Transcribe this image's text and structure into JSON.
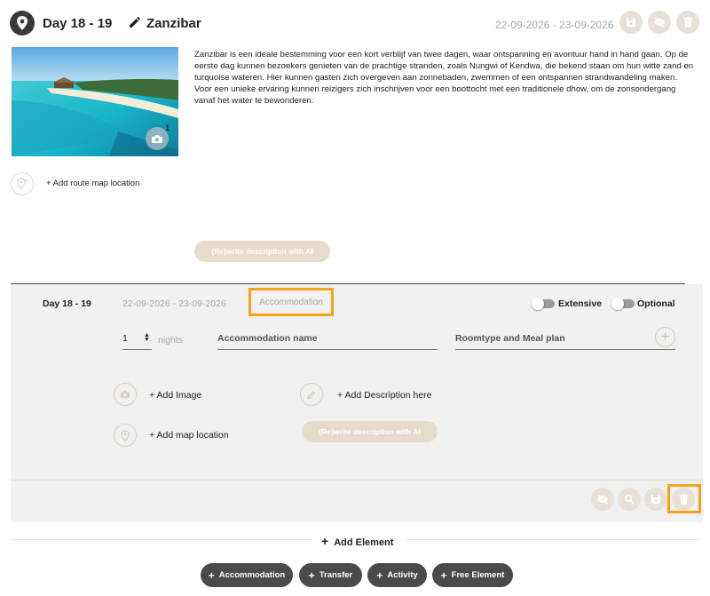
{
  "header": {
    "day_range": "Day 18 - 19",
    "destination": "Zanzibar",
    "dates": "22-09-2026 - 23-09-2026",
    "photo_count": "1"
  },
  "description": "Zanzibar is een ideale bestemming voor een kort verblijf van twee dagen, waar ontspanning en avontuur hand in hand gaan. Op de eerste dag kunnen bezoekers genieten van de prachtige stranden, zoals Nungwi of Kendwa, die bekend staan om hun witte zand en turquoise wateren. Hier kunnen gasten zich overgeven aan zonnebaden, zwemmen of een ontspannen strandwandeling maken. Voor een unieke ervaring kunnen reizigers zich inschrijven voor een boottocht met een traditionele dhow, om de zonsondergang vanaf het water te bewonderen.",
  "route_map_link": "+ Add route map location",
  "rewrite_ai_label": "(Re)write description with AI",
  "element": {
    "day_range": "Day 18 - 19",
    "dates": "22-09-2026 - 23-09-2026",
    "type": "Accommodation",
    "extensive_label": "Extensive",
    "optional_label": "Optional",
    "nights_value": "1",
    "nights_label": "nights",
    "accommodation_name_placeholder": "Accommodation name",
    "roomtype_placeholder": "Roomtype and Meal plan",
    "add_image": "+ Add Image",
    "add_description": "+ Add Description here",
    "add_map_location": "+ Add map location",
    "rewrite_ai_label": "(Re)write description with AI"
  },
  "add_element": {
    "label": "Add Element",
    "buttons": [
      "Accommodation",
      "Transfer",
      "Activity",
      "Free Element"
    ]
  },
  "colors": {
    "accent_tan": "#e7dccb",
    "highlight_orange": "#f5a31a",
    "dark_pill": "#4a4a4a"
  }
}
